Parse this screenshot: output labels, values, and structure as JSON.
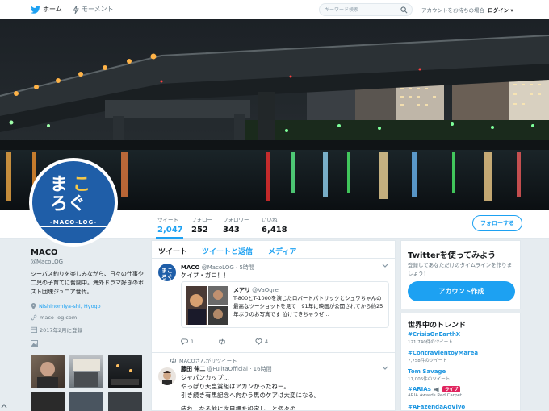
{
  "nav": {
    "home": "ホーム",
    "moments": "モーメント",
    "search_placeholder": "キーワード検索",
    "account_prompt": "アカウントをお持ちの場合",
    "login": "ログイン"
  },
  "stats": [
    {
      "label": "ツイート",
      "value": "2,047"
    },
    {
      "label": "フォロー",
      "value": "252"
    },
    {
      "label": "フォロワー",
      "value": "343"
    },
    {
      "label": "いいね",
      "value": "6,418"
    }
  ],
  "follow_button": "フォローする",
  "avatar": {
    "line1a": "ま",
    "line1b": "こ",
    "line2": "ろぐ",
    "band": "-MACO-LOG-"
  },
  "profile": {
    "name": "MACO",
    "handle": "@MacoLOG",
    "bio": "シーバス釣りを楽しみながら、日々の仕事や二児の子育てに奮闘中。海外ドラマ好きのポスト団塊ジュニア世代。",
    "location": "Nishinomiya-shi, Hyogo",
    "website": "maco-log.com",
    "joined": "2017年2月に登録"
  },
  "tabs": {
    "tweets": "ツイート",
    "replies": "ツイートと返信",
    "media": "メディア"
  },
  "tweet1": {
    "name": "MACO",
    "handle": "@MacoLOG",
    "time": "· 5時間",
    "text": "ケイプ・ガロ！！",
    "quote_name": "メアリ",
    "quote_handle": "@VaOgre",
    "quote_text": "T-800とT-1000を演じたロバートパトリックとシュワちゃんの最高なツーショットを見て　91年に映画が公開されてから約25年ぶりのお写真です 泣けてきちゃうぜ…",
    "reply_count": "1",
    "rt_count": "",
    "like_count": "4"
  },
  "tweet2": {
    "retweeted_by": "MACOさんがリツイート",
    "name": "藤田 伸二",
    "handle": "@FujitaOfficial",
    "time": "· 16時間",
    "line1": "ジャパンカップ…",
    "line2": "やっぱり天皇賞組はアカンかったねー。",
    "line3": "引き続き有馬記念へ向かう馬のケアは大変になる。",
    "line4": "疲れ…なる前に次目標を設定し…と個々の…"
  },
  "signup": {
    "title": "Twitterを使ってみよう",
    "subtitle": "登録してあなただけのタイムラインを作りましょう！",
    "button": "アカウント作成"
  },
  "trends": {
    "title": "世界中のトレンド",
    "items": [
      {
        "name": "#CrisisOnEarthX",
        "count": "121,740件のツイート"
      },
      {
        "name": "#ContraVientoyMarea",
        "count": "7,758件のツイート"
      },
      {
        "name": "Tom Savage",
        "count": "11,005件のツイート"
      },
      {
        "name": "#ARIAs",
        "count": "ARIA Awards Red Carpet",
        "badge": "ライブ"
      },
      {
        "name": "#AFazendaAoVivo",
        "count": ""
      }
    ]
  },
  "colors": {
    "accent": "#1da1f2",
    "live": "#e0245e",
    "avatar_bg": "#1f5ea8"
  }
}
